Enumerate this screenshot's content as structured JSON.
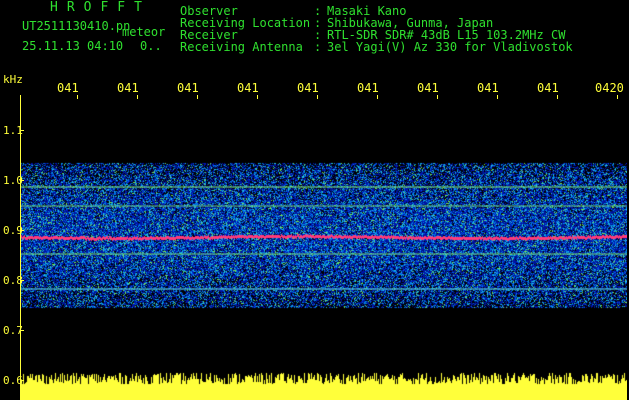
{
  "header": {
    "app_title": "HROFFT",
    "filename": "UT2511130410.pn",
    "filename_suffix": "meteor",
    "datetime": "25.11.13 04:10",
    "datetime_extra": "0..",
    "fields": [
      {
        "label": "Observer",
        "value": "Masaki Kano"
      },
      {
        "label": "Receiving Location",
        "value": "Shibukawa, Gunma, Japan"
      },
      {
        "label": "Receiver",
        "value": "RTL-SDR SDR# 43dB L15 103.2MHz CW"
      },
      {
        "label": "Receiving Antenna",
        "value": "3el Yagi(V) Az 330 for Vladivostok"
      }
    ],
    "colon": ":"
  },
  "axis": {
    "unit_label": "kHz",
    "y_ticks": [
      "1.1",
      "1.0",
      "0.9",
      "0.8",
      "0.7",
      "0.6"
    ],
    "x_ticks": [
      "041",
      "041",
      "041",
      "041",
      "041",
      "041",
      "041",
      "041",
      "041",
      "0420"
    ]
  },
  "colors": {
    "background": "#000000",
    "header_green": "#2fe02f",
    "text_yellow": "#ffff3a",
    "carrier_line": "#ff3a7a"
  }
}
